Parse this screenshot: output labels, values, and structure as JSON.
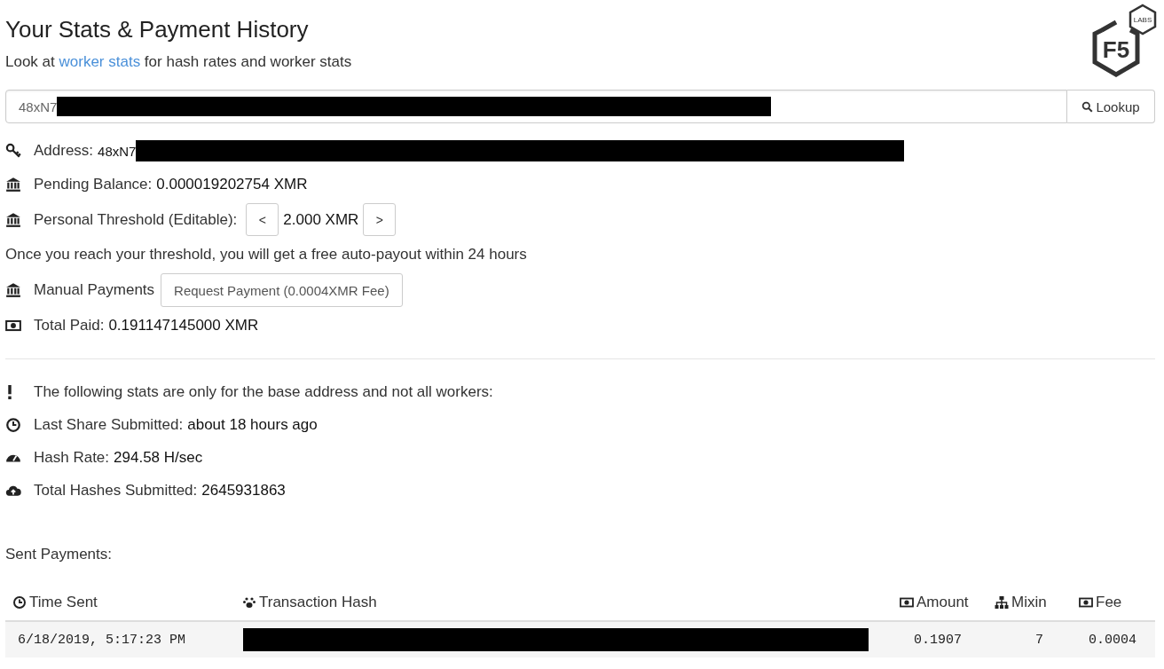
{
  "header": {
    "title": "Your Stats & Payment History",
    "subtitle": {
      "before": "Look at ",
      "link": "worker stats",
      "after": " for hash rates and worker stats"
    }
  },
  "logo": {
    "text": "F5",
    "badge": "LABS"
  },
  "lookup": {
    "value": "48xN7",
    "redacted": true,
    "button": "Lookup"
  },
  "account": [
    {
      "kind": "address",
      "label": "Address:",
      "value": "48xN7",
      "redacted": true
    },
    {
      "kind": "balance",
      "label": "Pending Balance:",
      "value": "0.000019202754 XMR"
    },
    {
      "kind": "threshold",
      "label": "Personal Threshold (Editable):",
      "decrease": "<",
      "value": "2.000 XMR",
      "increase": ">"
    },
    {
      "kind": "note",
      "text": "Once you reach your threshold, you will get a free auto-payout within 24 hours"
    },
    {
      "kind": "action",
      "label": "Manual Payments",
      "button": "Request Payment (0.0004XMR Fee)"
    },
    {
      "kind": "paid",
      "label": "Total Paid:",
      "value": "0.191147145000 XMR"
    }
  ],
  "stats": [
    {
      "kind": "warning",
      "text": "The following stats are only for the base address and not all workers:"
    },
    {
      "kind": "last_share",
      "label": "Last Share Submitted:",
      "value": "about 18 hours ago"
    },
    {
      "kind": "hash_rate",
      "label": "Hash Rate:",
      "value": "294.58 H/sec"
    },
    {
      "kind": "total_hashes",
      "label": "Total Hashes Submitted:",
      "value": "2645931863"
    }
  ],
  "sent_payments": {
    "title": "Sent Payments:",
    "columns": [
      {
        "label": "Time Sent"
      },
      {
        "label": "Transaction Hash"
      },
      {
        "label": "Amount"
      },
      {
        "label": "Mixin"
      },
      {
        "label": "Fee"
      }
    ],
    "rows": [
      {
        "time_sent": "6/18/2019, 5:17:23 PM",
        "transaction_hash_redacted": true,
        "amount": "0.1907",
        "mixin": "7",
        "fee": "0.0004"
      }
    ]
  }
}
